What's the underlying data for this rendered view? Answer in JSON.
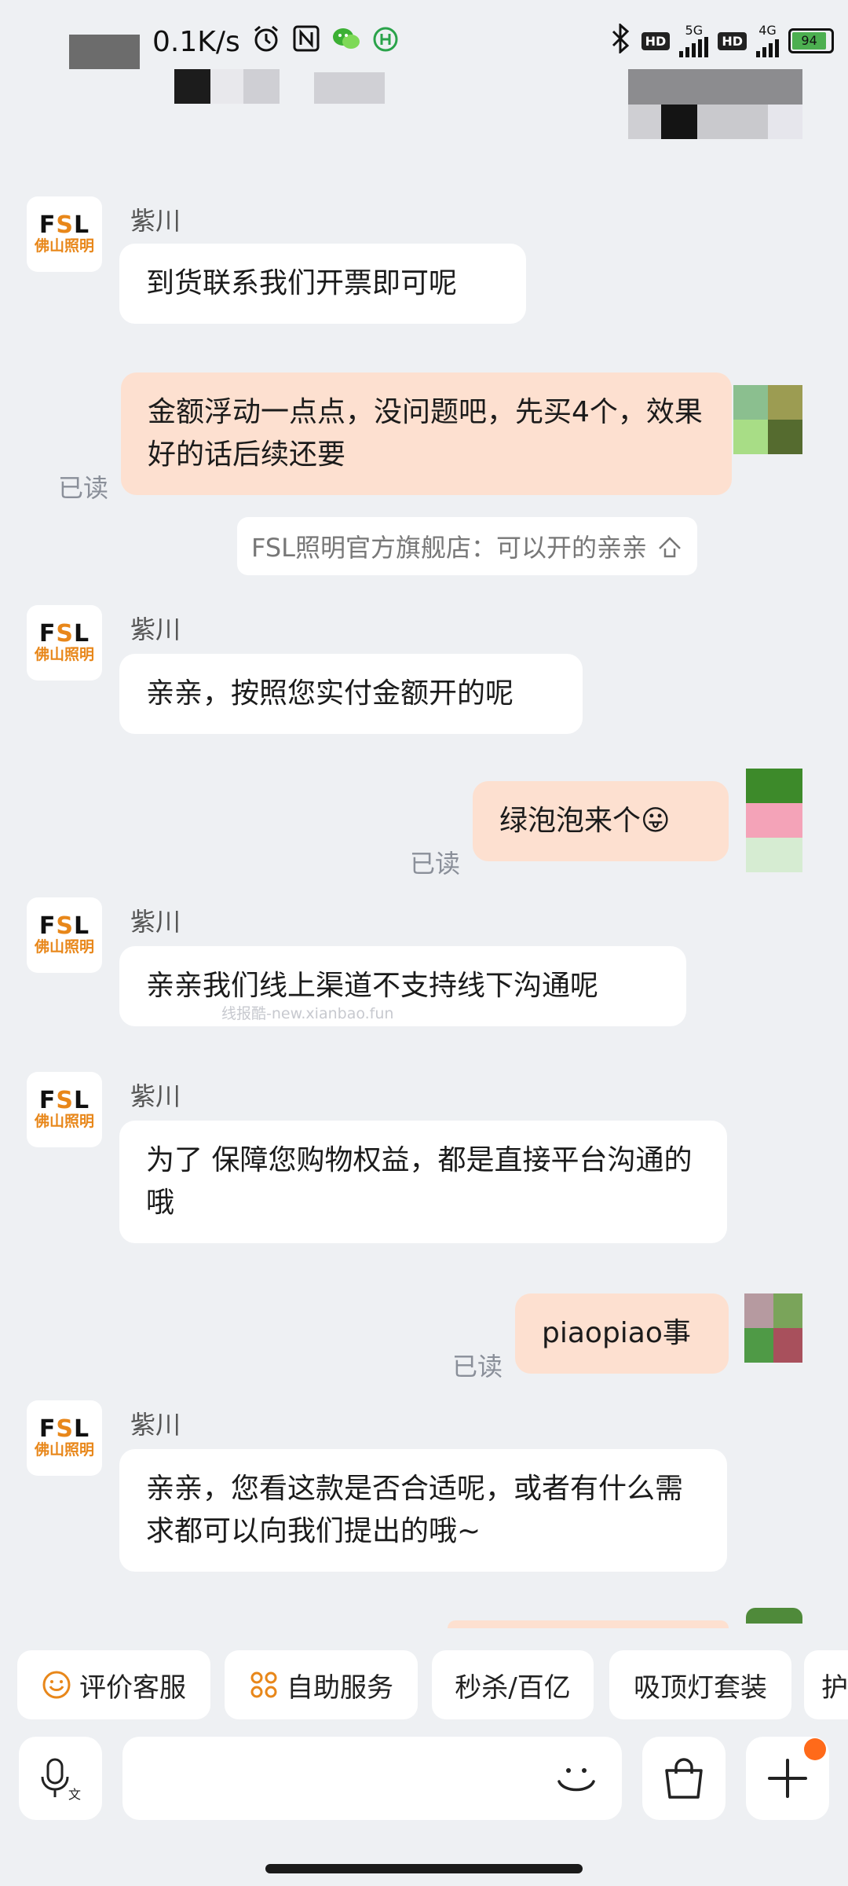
{
  "status_bar": {
    "speed": "0.1K/s",
    "net1": "5G",
    "net2": "4G",
    "hd": "HD",
    "battery": "94"
  },
  "messages": [
    {
      "type": "in",
      "sender": "紫川",
      "text": "到货联系我们开票即可呢"
    },
    {
      "type": "out",
      "read": "已读",
      "text": "金额浮动一点点，没问题吧，先买4个，效果好的话后续还要"
    },
    {
      "type": "quote",
      "text": "FSL照明官方旗舰店：可以开的亲亲"
    },
    {
      "type": "in",
      "sender": "紫川",
      "text": "亲亲，按照您实付金额开的呢"
    },
    {
      "type": "out",
      "read": "已读",
      "text": "绿泡泡来个😛"
    },
    {
      "type": "in",
      "sender": "紫川",
      "text": "亲亲我们线上渠道不支持线下沟通呢"
    },
    {
      "type": "in",
      "sender": "紫川",
      "text": "为了 保障您购物权益，都是直接平台沟通的哦"
    },
    {
      "type": "out",
      "read": "已读",
      "text": "piaopiao事"
    },
    {
      "type": "in",
      "sender": "紫川",
      "text": "亲亲，您看这款是否合适呢，或者有什么需求都可以向我们提出的哦~"
    }
  ],
  "avatar": {
    "brand_prefix": "F",
    "brand_mid": "S",
    "brand_suffix": "L",
    "cn": "佛山照明"
  },
  "watermark": "线报酷-new.xianbao.fun",
  "quick_replies": [
    "评价客服",
    "自助服务",
    "秒杀/百亿",
    "吸顶灯套装",
    "护"
  ],
  "colors": {
    "accent": "#e8871a",
    "out_bubble": "#fde0d0",
    "badge": "#ff6a1a"
  }
}
